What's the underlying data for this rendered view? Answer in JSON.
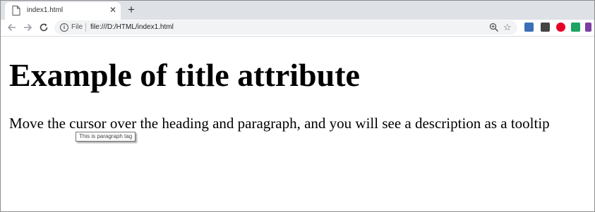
{
  "tab": {
    "title": "index1.html",
    "close": "✕",
    "new_tab": "+"
  },
  "toolbar": {
    "scheme_label": "File",
    "url": "file:///D:/HTML/index1.html",
    "info_glyph": "i",
    "star_glyph": "☆"
  },
  "extensions": [
    {
      "name": "ext-blue-icon",
      "color": "#3b6fb6"
    },
    {
      "name": "ext-m-icon",
      "color": "#444444"
    },
    {
      "name": "pinterest-icon",
      "color": "#e60023"
    },
    {
      "name": "ext-green-icon",
      "color": "#1da462"
    },
    {
      "name": "ext-multicolor-icon",
      "color": "#7b3fa0"
    }
  ],
  "page": {
    "heading": "Example of title attribute",
    "paragraph": "Move the cursor over the heading and paragraph, and you will see a description as a tooltip",
    "tooltip": "This is paragraph tag"
  }
}
